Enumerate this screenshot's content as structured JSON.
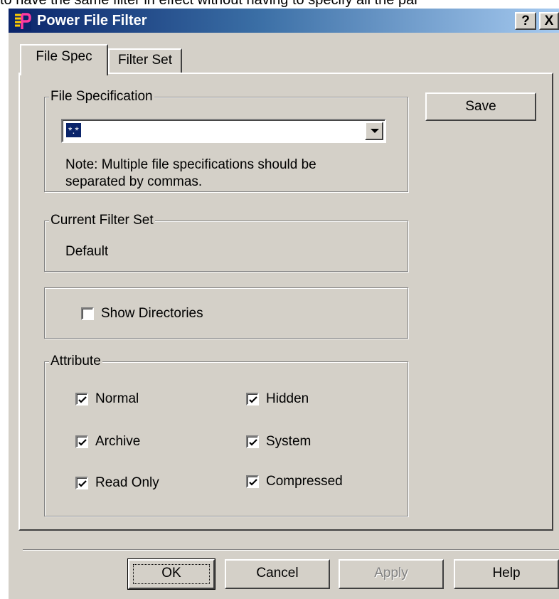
{
  "background_text": "to have the same filter in effect without having to specify all the par",
  "window": {
    "title": "Power File Filter",
    "help_button": "?",
    "close_button": "X"
  },
  "tabs": [
    {
      "label": "File Spec",
      "active": true
    },
    {
      "label": "Filter Set",
      "active": false
    }
  ],
  "file_spec": {
    "group_label": "File Specification",
    "combo_value": "*.*",
    "note": "Note: Multiple file specifications should be separated by commas.",
    "note_line1": "Note: Multiple file specifications should be",
    "note_line2": "separated by commas."
  },
  "save_button": "Save",
  "current_filter_set": {
    "group_label": "Current Filter Set",
    "value": "Default"
  },
  "show_directories": {
    "label": "Show Directories",
    "checked": false
  },
  "attribute": {
    "group_label": "Attribute",
    "items": [
      {
        "label": "Normal",
        "checked": true
      },
      {
        "label": "Hidden",
        "checked": true
      },
      {
        "label": "Archive",
        "checked": true
      },
      {
        "label": "System",
        "checked": true
      },
      {
        "label": "Read Only",
        "checked": true
      },
      {
        "label": "Compressed",
        "checked": true
      }
    ]
  },
  "buttons": {
    "ok": "OK",
    "cancel": "Cancel",
    "apply": "Apply",
    "help": "Help"
  },
  "colors": {
    "dialog_face": "#d4d0c8",
    "title_gradient_start": "#0a246a",
    "title_gradient_end": "#a6caf0",
    "selection": "#0a246a"
  },
  "icons": {
    "app": "power-file-filter-icon",
    "dropdown": "chevron-down-icon",
    "check": "checkmark-icon"
  }
}
